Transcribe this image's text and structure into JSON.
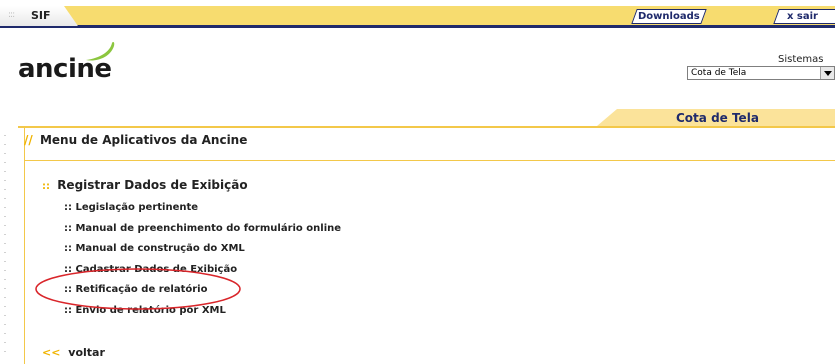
{
  "topbar": {
    "sif_label": "SIF",
    "downloads_label": "Downloads",
    "sair_label": "x sair"
  },
  "logo": {
    "text": "ancine"
  },
  "sistemas": {
    "label": "Sistemas",
    "selected": "Cota de Tela"
  },
  "tab": {
    "label": "Cota de Tela"
  },
  "menu": {
    "title": "Menu de Aplicativos da Ancine",
    "title_prefix": "//",
    "section": {
      "bullet": "::",
      "heading": "Registrar Dados de Exibição",
      "items": [
        {
          "label": ":: Legislação pertinente"
        },
        {
          "label": ":: Manual de preenchimento do formulário online"
        },
        {
          "label": ":: Manual de construção do XML"
        },
        {
          "label": ":: Cadastrar Dados de Exibição"
        },
        {
          "label": ":: Retificação de relatório"
        },
        {
          "label": ":: Envio de relatório por XML"
        }
      ]
    }
  },
  "back": {
    "arrows": "<<",
    "label": "voltar"
  },
  "colors": {
    "accent_gold": "#f3c84a",
    "navy": "#1f2a6b",
    "annotation_red": "#d9252a",
    "swoosh_green": "#8cc63f"
  }
}
